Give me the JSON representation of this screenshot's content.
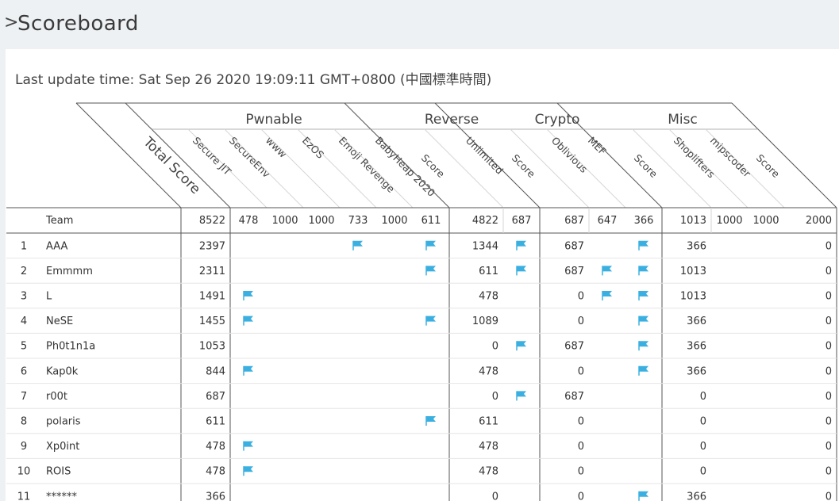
{
  "header": {
    "chevron": ">",
    "title": "Scoreboard"
  },
  "update": {
    "text": "Last update time: Sat Sep 26 2020 19:09:11 GMT+0800 (中國標準時間)"
  },
  "table": {
    "team_header": "Team",
    "total_label": "Total Score",
    "total_max": "8522",
    "categories": [
      {
        "name": "Pwnable",
        "challenges": [
          {
            "name": "Secure JIT",
            "points": "478"
          },
          {
            "name": "SecureEnv",
            "points": "1000"
          },
          {
            "name": "www",
            "points": "1000"
          },
          {
            "name": "EzOS",
            "points": "733"
          },
          {
            "name": "Emoji Revenge",
            "points": "1000"
          },
          {
            "name": "BabyHeap 2020",
            "points": "611"
          }
        ],
        "score_label": "Score",
        "score_max": "4822"
      },
      {
        "name": "Reverse",
        "challenges": [
          {
            "name": "Unlimited",
            "points": "687"
          }
        ],
        "score_label": "Score",
        "score_max": "687"
      },
      {
        "name": "Crypto",
        "challenges": [
          {
            "name": "Oblivious",
            "points": "647"
          },
          {
            "name": "MEF",
            "points": "366"
          }
        ],
        "score_label": "Score",
        "score_max": "1013"
      },
      {
        "name": "Misc",
        "challenges": [
          {
            "name": "Shoplifters",
            "points": "1000"
          },
          {
            "name": "mipscoder",
            "points": "1000"
          }
        ],
        "score_label": "Score",
        "score_max": "2000"
      }
    ],
    "flag_icon": "flag-icon",
    "flag_color": "#3bb0e0",
    "rows": [
      {
        "rank": "1",
        "team": "AAA",
        "total": "2397",
        "solves": [
          0,
          0,
          0,
          1,
          0,
          1,
          1,
          0,
          1,
          0,
          0
        ],
        "scores": [
          "1344",
          "687",
          "366",
          "0"
        ]
      },
      {
        "rank": "2",
        "team": "Emmmm",
        "total": "2311",
        "solves": [
          0,
          0,
          0,
          0,
          0,
          1,
          1,
          1,
          1,
          0,
          0
        ],
        "scores": [
          "611",
          "687",
          "1013",
          "0"
        ]
      },
      {
        "rank": "3",
        "team": "L",
        "total": "1491",
        "solves": [
          1,
          0,
          0,
          0,
          0,
          0,
          0,
          1,
          1,
          0,
          0
        ],
        "scores": [
          "478",
          "0",
          "1013",
          "0"
        ]
      },
      {
        "rank": "4",
        "team": "NeSE",
        "total": "1455",
        "solves": [
          1,
          0,
          0,
          0,
          0,
          1,
          0,
          0,
          1,
          0,
          0
        ],
        "scores": [
          "1089",
          "0",
          "366",
          "0"
        ]
      },
      {
        "rank": "5",
        "team": "Ph0t1n1a",
        "total": "1053",
        "solves": [
          0,
          0,
          0,
          0,
          0,
          0,
          1,
          0,
          1,
          0,
          0
        ],
        "scores": [
          "0",
          "687",
          "366",
          "0"
        ]
      },
      {
        "rank": "6",
        "team": "Kap0k",
        "total": "844",
        "solves": [
          1,
          0,
          0,
          0,
          0,
          0,
          0,
          0,
          1,
          0,
          0
        ],
        "scores": [
          "478",
          "0",
          "366",
          "0"
        ]
      },
      {
        "rank": "7",
        "team": "r00t",
        "total": "687",
        "solves": [
          0,
          0,
          0,
          0,
          0,
          0,
          1,
          0,
          0,
          0,
          0
        ],
        "scores": [
          "0",
          "687",
          "0",
          "0"
        ]
      },
      {
        "rank": "8",
        "team": "polaris",
        "total": "611",
        "solves": [
          0,
          0,
          0,
          0,
          0,
          1,
          0,
          0,
          0,
          0,
          0
        ],
        "scores": [
          "611",
          "0",
          "0",
          "0"
        ]
      },
      {
        "rank": "9",
        "team": "Xp0int",
        "total": "478",
        "solves": [
          1,
          0,
          0,
          0,
          0,
          0,
          0,
          0,
          0,
          0,
          0
        ],
        "scores": [
          "478",
          "0",
          "0",
          "0"
        ]
      },
      {
        "rank": "10",
        "team": "ROIS",
        "total": "478",
        "solves": [
          1,
          0,
          0,
          0,
          0,
          0,
          0,
          0,
          0,
          0,
          0
        ],
        "scores": [
          "478",
          "0",
          "0",
          "0"
        ]
      },
      {
        "rank": "11",
        "team": "******",
        "total": "366",
        "solves": [
          0,
          0,
          0,
          0,
          0,
          0,
          0,
          0,
          1,
          0,
          0
        ],
        "scores": [
          "0",
          "0",
          "366",
          "0"
        ]
      }
    ]
  }
}
